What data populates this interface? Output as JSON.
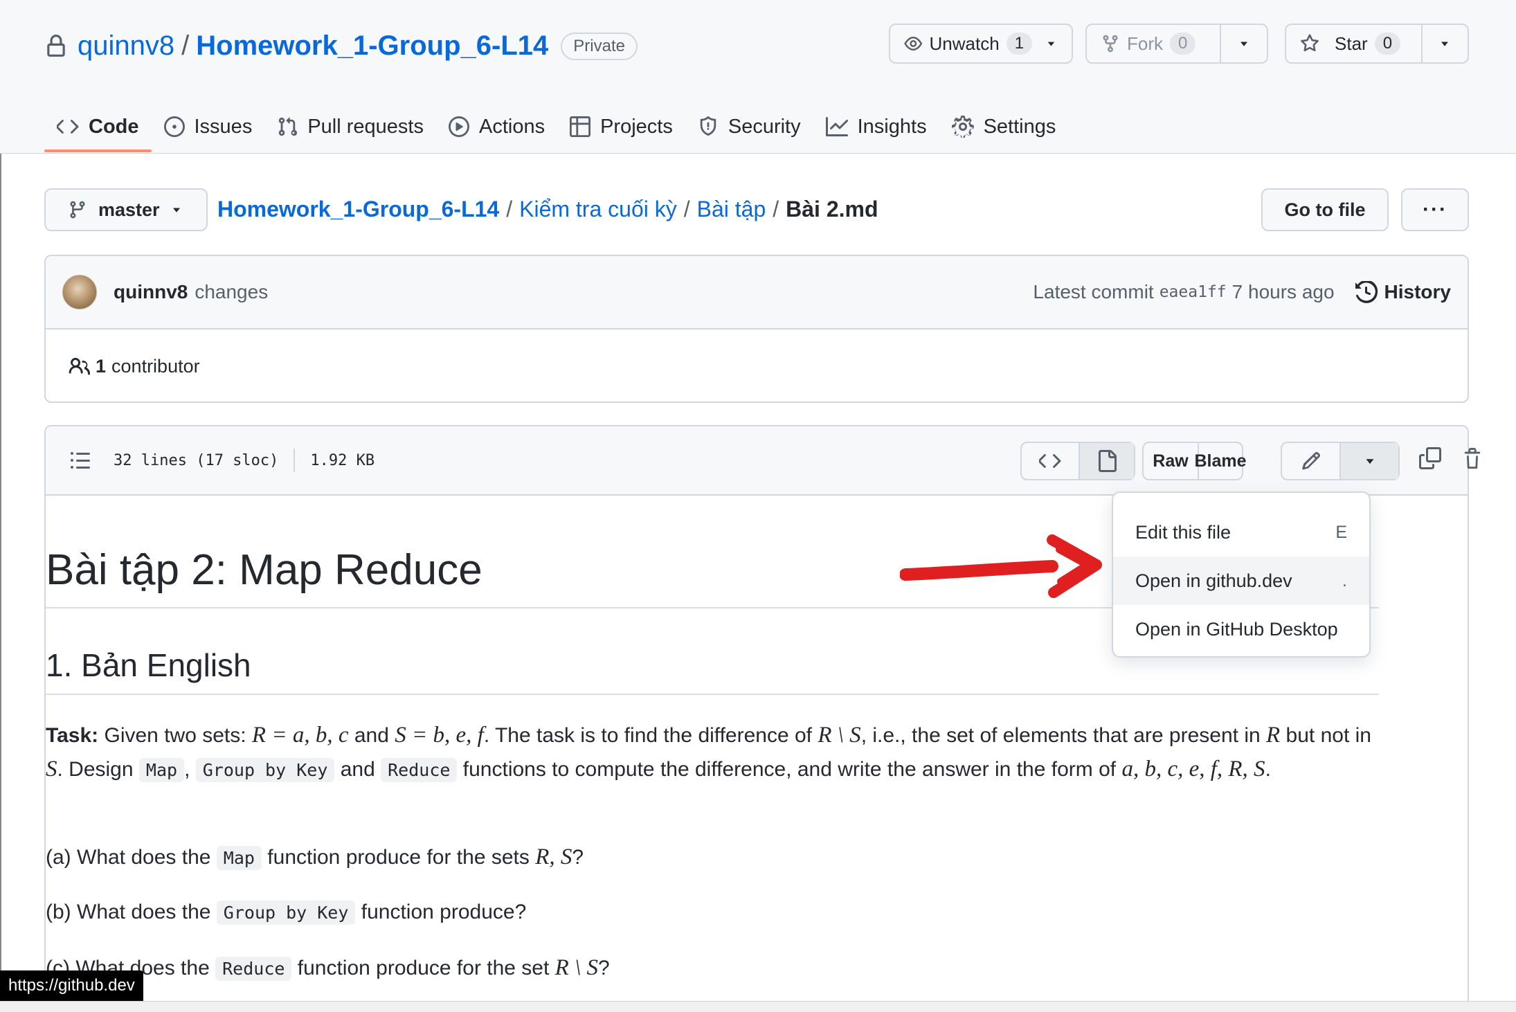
{
  "repo": {
    "owner": "quinnv8",
    "name": "Homework_1-Group_6-L14",
    "visibility": "Private"
  },
  "actions": {
    "watch": {
      "label": "Unwatch",
      "count": "1"
    },
    "fork": {
      "label": "Fork",
      "count": "0"
    },
    "star": {
      "label": "Star",
      "count": "0"
    }
  },
  "tabs": [
    {
      "label": "Code",
      "icon": "code-icon",
      "active": true
    },
    {
      "label": "Issues",
      "icon": "issue-icon"
    },
    {
      "label": "Pull requests",
      "icon": "pull-request-icon"
    },
    {
      "label": "Actions",
      "icon": "play-icon"
    },
    {
      "label": "Projects",
      "icon": "table-icon"
    },
    {
      "label": "Security",
      "icon": "shield-icon"
    },
    {
      "label": "Insights",
      "icon": "graph-icon"
    },
    {
      "label": "Settings",
      "icon": "gear-icon"
    }
  ],
  "branch": "master",
  "breadcrumb": {
    "repo": "Homework_1-Group_6-L14",
    "folder1": "Kiểm tra cuối kỳ",
    "folder2": "Bài tập",
    "file": "Bài 2.md",
    "sep": "/"
  },
  "goto_file": "Go to file",
  "more_label": "···",
  "commit": {
    "author": "quinnv8",
    "message": "changes",
    "latest_label": "Latest commit",
    "sha": "eaea1ff",
    "time": "7 hours ago",
    "history_label": "History",
    "contributors_count": "1",
    "contributors_label": "contributor"
  },
  "file": {
    "lines": "32 lines (17 sloc)",
    "size": "1.92 KB",
    "raw_label": "Raw",
    "blame_label": "Blame"
  },
  "dropdown": {
    "items": [
      {
        "label": "Edit this file",
        "key": "E"
      },
      {
        "label": "Open in github.dev",
        "key": "."
      },
      {
        "label": "Open in GitHub Desktop",
        "key": ""
      }
    ]
  },
  "markdown": {
    "h1": "Bài tập 2: Map Reduce",
    "h2": "1. Bản English",
    "task_label": "Task:",
    "text_given": "Given two sets:",
    "math_r_set": "R = a, b, c",
    "text_and1": "and",
    "math_s_set": "S = b, e, f",
    "text_diff": ". The task is to find the difference of",
    "math_r_minus_s": "R \\ S",
    "text_ie": ", i.e., the set of elements that are present in",
    "math_r": "R",
    "text_butnot": "but not in",
    "math_s": "S",
    "text_design": ". Design",
    "code_map": "Map",
    "text_comma": ",",
    "code_group": "Group by Key",
    "text_and2": "and",
    "code_reduce": "Reduce",
    "text_functions": "functions to compute the difference, and write the answer in the form of",
    "math_form": "a, b, c, e, f, R, S",
    "text_period": ".",
    "qa_prefix": "(a) What does the",
    "qa_suffix": "function produce for the sets",
    "qa_math": "R, S",
    "qa_end": "?",
    "qb_prefix": "(b) What does the",
    "qb_suffix": "function produce?",
    "qc_prefix": "(c) What does the",
    "qc_suffix": "function produce for the set",
    "qc_math": "R \\ S",
    "qc_end": "?"
  },
  "status_url": "https://github.dev",
  "colors": {
    "link": "#0969da",
    "tab_underline": "#fd8c73",
    "annotation_arrow": "#e02020"
  }
}
